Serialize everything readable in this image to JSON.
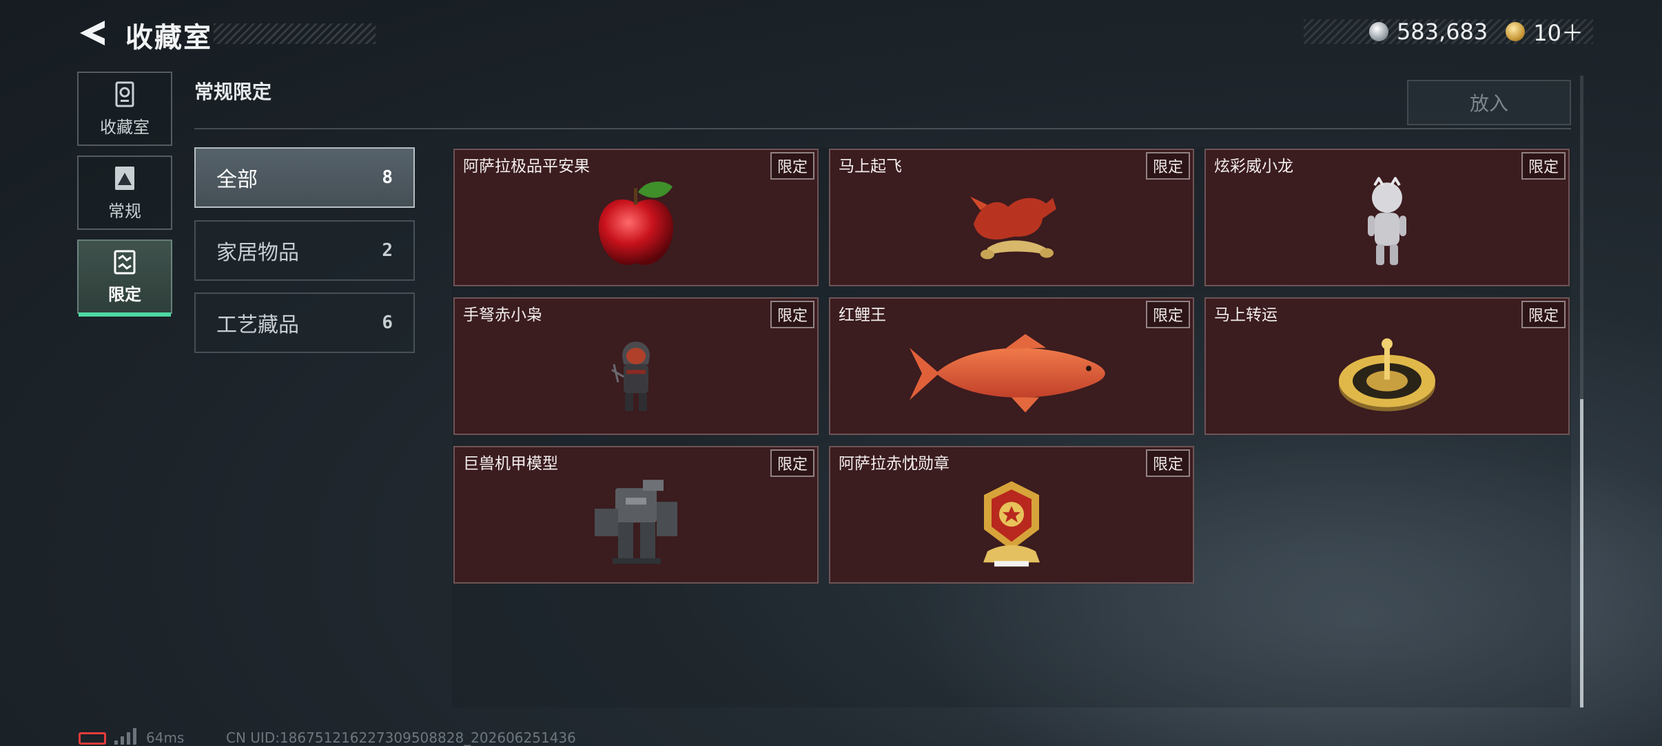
{
  "header": {
    "title": "收藏室",
    "currency": [
      {
        "icon": "silver-coin-icon",
        "value": "583,683"
      },
      {
        "icon": "gold-coin-icon",
        "value": "10＋"
      }
    ]
  },
  "nav": {
    "items": [
      {
        "label": "收藏室",
        "icon": "collection-icon"
      },
      {
        "label": "常规",
        "icon": "regular-icon"
      },
      {
        "label": "限定",
        "icon": "limited-icon",
        "active": true
      }
    ]
  },
  "section": {
    "title": "常规限定",
    "put_button": "放入"
  },
  "categories": [
    {
      "label": "全部",
      "count": "8",
      "active": true
    },
    {
      "label": "家居物品",
      "count": "2"
    },
    {
      "label": "工艺藏品",
      "count": "6"
    }
  ],
  "items": [
    {
      "name": "阿萨拉极品平安果",
      "tag": "限定",
      "image": "red-apple"
    },
    {
      "name": "马上起飞",
      "tag": "限定",
      "image": "horse-figurine"
    },
    {
      "name": "炫彩威小龙",
      "tag": "限定",
      "image": "white-dragon-figure"
    },
    {
      "name": "手弩赤小枭",
      "tag": "限定",
      "image": "hooded-figure"
    },
    {
      "name": "红鲤王",
      "tag": "限定",
      "image": "red-carp"
    },
    {
      "name": "马上转运",
      "tag": "限定",
      "image": "gold-compass-disc"
    },
    {
      "name": "巨兽机甲模型",
      "tag": "限定",
      "image": "mech-model"
    },
    {
      "name": "阿萨拉赤忱勋章",
      "tag": "限定",
      "image": "gold-medal"
    }
  ],
  "footer": {
    "ping": "64ms",
    "uid": "CN UID:1867512162273095088​28_202606251436"
  },
  "colors": {
    "accent": "#4fd8a4",
    "card_bg": "#3b1c1f",
    "battery_low": "#e63b3b"
  }
}
